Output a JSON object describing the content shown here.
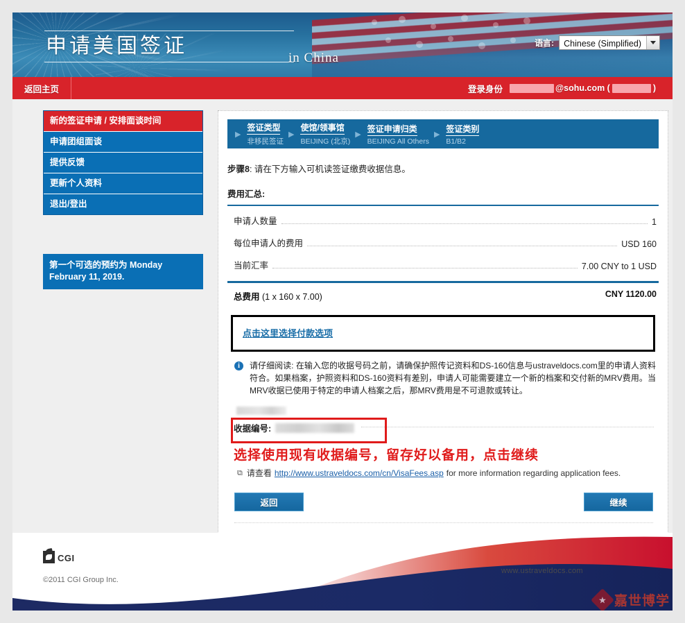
{
  "header": {
    "title": "申请美国签证",
    "subtitle": "in China",
    "language_label": "语言:",
    "language_value": "Chinese (Simplified)",
    "dropdown_icon": "chevron-down-icon"
  },
  "navbar": {
    "home_label": "返回主页",
    "login_label": "登录身份",
    "email_suffix": "@sohu.com (",
    "email_close": ")"
  },
  "sidebar": {
    "items": [
      {
        "label": "新的签证申请 / 安排面谈时间",
        "active": true
      },
      {
        "label": "申请团组面谈",
        "active": false
      },
      {
        "label": "提供反馈",
        "active": false
      },
      {
        "label": "更新个人资料",
        "active": false
      },
      {
        "label": "退出/登出",
        "active": false
      }
    ],
    "notice": "第一个可选的预约为 Monday February 11, 2019."
  },
  "steps": [
    {
      "title": "签证类型",
      "sub": "非移民签证"
    },
    {
      "title": "使馆/领事馆",
      "sub": "BEIJING (北京)"
    },
    {
      "title": "签证申请归类",
      "sub": "BEIJING All Others"
    },
    {
      "title": "签证类别",
      "sub": "B1/B2"
    }
  ],
  "main": {
    "step_prefix": "步骤8",
    "step_instruction": ": 请在下方输入可机读签证缴费收据信息。",
    "summary_title": "费用汇总:",
    "fee_rows": [
      {
        "label": "申请人数量",
        "value": "1"
      },
      {
        "label": "每位申请人的费用",
        "value": "USD 160"
      },
      {
        "label": "当前汇率",
        "value": "7.00 CNY to 1 USD"
      }
    ],
    "total_label": "总费用",
    "total_formula": " (1 x 160 x 7.00)",
    "total_value": "CNY 1120.00",
    "payment_link": "点击这里选择付款选项",
    "info_icon": "info-icon",
    "info_text": "请仔细阅读: 在输入您的收据号码之前，请确保护照传记资料和DS-160信息与ustraveldocs.com里的申请人资料符合。如果档案，护照资料和DS-160资料有差别，申请人可能需要建立一个新的档案和交付新的MRV费用。当MRV收据已使用于特定的申请人档案之后，那MRV费用是不可退款或转让。",
    "receipt_label": "收据编号:",
    "red_annotation": "选择使用现有收据编号，留存好以备用，点击继续",
    "fee_link_prefix": "请查看",
    "fee_link_url": "http://www.ustraveldocs.com/cn/VisaFees.asp",
    "fee_link_suffix": "for more information regarding application fees.",
    "external-link-icon": "⧉",
    "back_button": "返回",
    "continue_button": "继续"
  },
  "footer": {
    "logo_text": "CGI",
    "copyright": "©2011 CGI Group Inc.",
    "site_url": "www.ustraveldocs.com",
    "watermark_text": "嘉世博学",
    "watermark_icon": "graduation-cap-icon"
  },
  "colors": {
    "red": "#d8232a",
    "blue": "#0a6fb5",
    "steps_blue": "#16699e",
    "annotation_red": "#e01b1b"
  }
}
